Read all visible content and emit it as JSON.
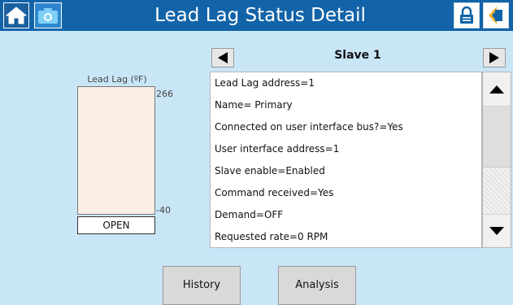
{
  "header": {
    "title": "Lead Lag Status Detail",
    "icons": [
      "home-icon",
      "camera-icon",
      "lock-icon",
      "back-icon"
    ]
  },
  "gauge": {
    "label": "Lead Lag (ºF)",
    "max": "266",
    "min": "-40",
    "status": "OPEN"
  },
  "slave": {
    "title": "Slave 1"
  },
  "list": {
    "items": [
      "Lead Lag address=1",
      "Name= Primary",
      "Connected on user interface bus?=Yes",
      "User interface address=1",
      "Slave enable=Enabled",
      "Command received=Yes",
      "Demand=OFF",
      "Requested rate=0 RPM"
    ]
  },
  "buttons": {
    "history": "History",
    "analysis": "Analysis"
  },
  "colors": {
    "header_bg": "#1263a8",
    "page_bg": "#c9e6f7",
    "gauge_fill": "#fbeee4"
  }
}
